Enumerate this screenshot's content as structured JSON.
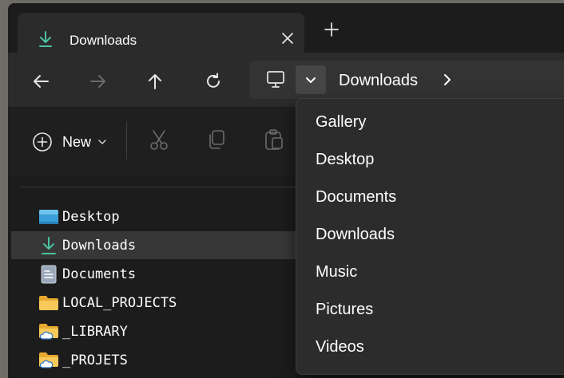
{
  "tab": {
    "title": "Downloads",
    "icon": "download-icon"
  },
  "toolbar": {
    "back": "arrow-left-icon",
    "forward": "arrow-right-icon",
    "up": "arrow-up-icon",
    "refresh": "refresh-icon"
  },
  "address": {
    "crumb": "Downloads"
  },
  "command_bar": {
    "new_label": "New"
  },
  "nav": {
    "items": [
      {
        "label": "Desktop",
        "icon": "desktop-folder-icon"
      },
      {
        "label": "Downloads",
        "icon": "download-icon",
        "selected": true
      },
      {
        "label": "Documents",
        "icon": "document-icon"
      },
      {
        "label": "LOCAL_PROJECTS",
        "icon": "folder-icon"
      },
      {
        "label": "_LIBRARY",
        "icon": "cloud-folder-icon"
      },
      {
        "label": "_PROJETS",
        "icon": "cloud-folder-icon"
      }
    ]
  },
  "menu": {
    "items": [
      "Gallery",
      "Desktop",
      "Documents",
      "Downloads",
      "Music",
      "Pictures",
      "Videos"
    ]
  },
  "colors": {
    "window_bg": "#1c1c1c",
    "tab_bg": "#2b2b2b",
    "menu_bg": "#2c2c2c",
    "accent_download": "#4cc2a0",
    "folder_yellow": "#f2c04d"
  }
}
